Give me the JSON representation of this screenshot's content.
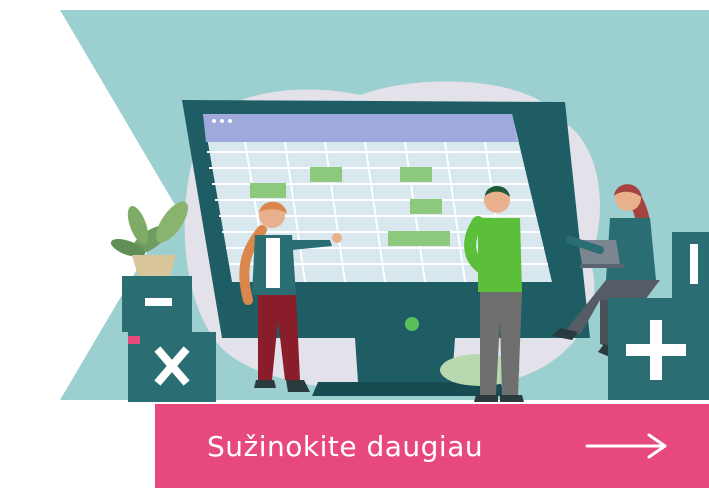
{
  "cta": {
    "label": "Sužinokite daugiau",
    "icon": "arrow-right-icon"
  },
  "colors": {
    "background_teal": "#9ccfcf",
    "blob_lilac": "#e3e1ea",
    "monitor_dark": "#1e5d63",
    "monitor_screen": "#d9e7ee",
    "monitor_header": "#9fa9dc",
    "grid_highlight": "#8cc97c",
    "cta_pink": "#e8497c",
    "box_teal": "#2a6d73",
    "text_white": "#ffffff"
  },
  "illustration": {
    "subject": "team-planning-calendar-on-large-monitor",
    "icons": [
      "minus-box-icon",
      "multiply-box-icon",
      "plus-box-icon",
      "potted-plant-icon",
      "laptop-icon"
    ]
  }
}
